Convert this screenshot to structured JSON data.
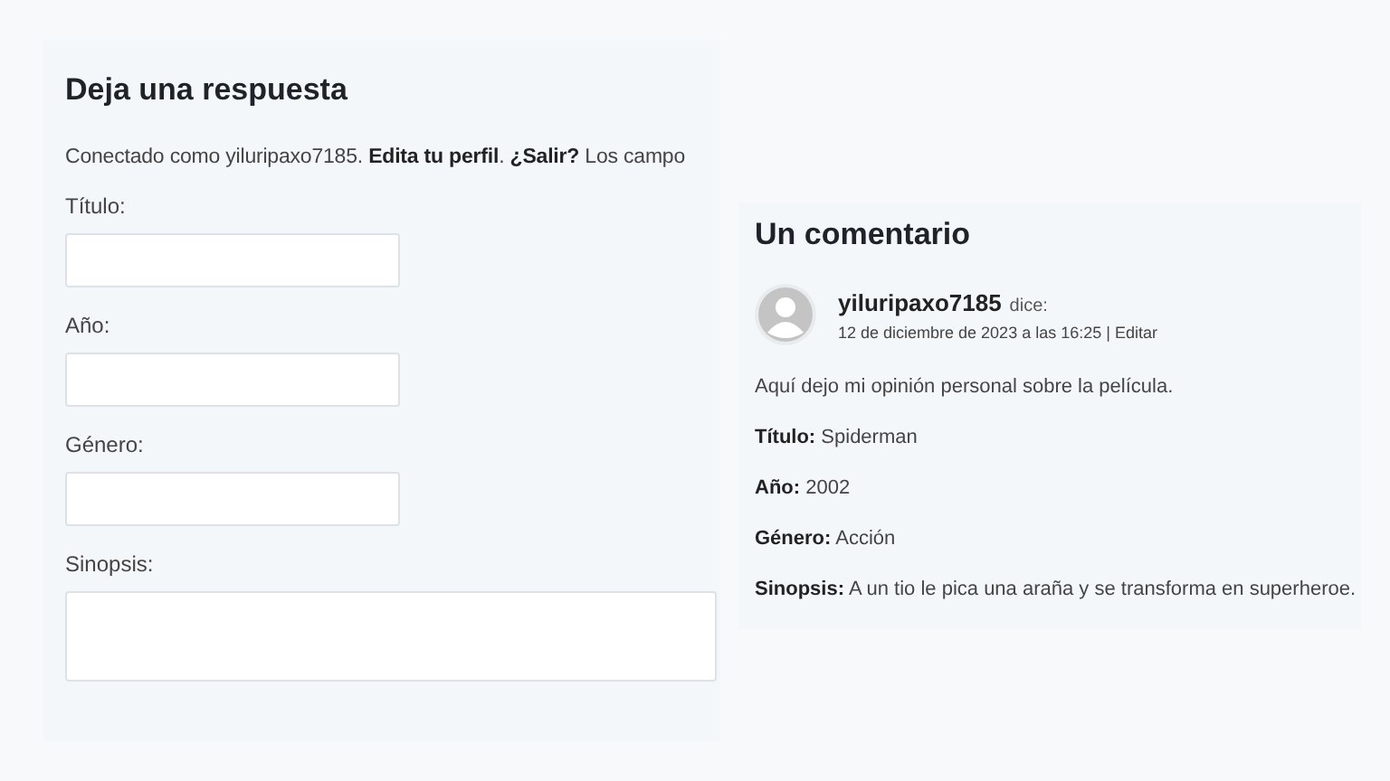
{
  "reply_form": {
    "title": "Deja una respuesta",
    "logged_in_text": "Conectado como yiluripaxo7185. **Edita tu perfil**. **¿Salir?** Los campo",
    "fields": [
      {
        "label": "Título:",
        "kind": "input"
      },
      {
        "label": "Año:",
        "kind": "input"
      },
      {
        "label": "Género:",
        "kind": "input"
      },
      {
        "label": "Sinopsis:",
        "kind": "textarea"
      }
    ]
  },
  "comments": {
    "title": "Un comentario",
    "comment": {
      "author": "yiluripaxo7185",
      "says": "dice:",
      "date": "12 de diciembre de 2023 a las 16:25",
      "separator": "|",
      "edit_link": "Editar",
      "paragraphs": [
        "Aquí dejo mi opinión personal sobre la película.",
        "**Título:** Spiderman",
        "**Año:** 2002",
        "**Género:** Acción",
        "**Sinopsis:** A un tio le pica una araña y se transforma en superheroe."
      ]
    }
  }
}
